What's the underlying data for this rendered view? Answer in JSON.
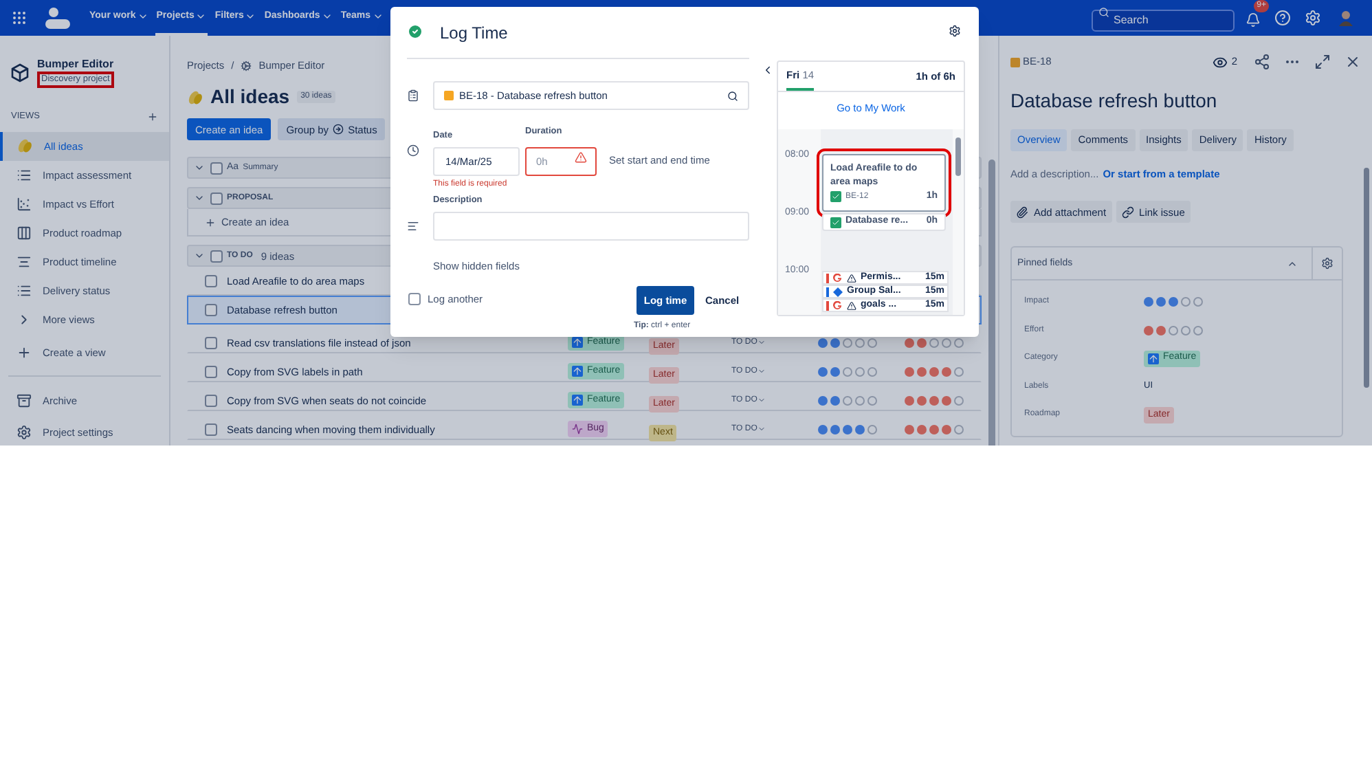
{
  "topnav": {
    "items": [
      {
        "label": "Your work",
        "selected": false
      },
      {
        "label": "Projects",
        "selected": true
      },
      {
        "label": "Filters",
        "selected": false
      },
      {
        "label": "Dashboards",
        "selected": false
      },
      {
        "label": "Teams",
        "selected": false
      }
    ],
    "search": {
      "placeholder": "Search"
    },
    "notifications_badge": "9+"
  },
  "sidebar": {
    "project_name": "Bumper Editor",
    "project_type": "Discovery project",
    "project_type_highlighted": true,
    "views_heading": "VIEWS",
    "items": [
      {
        "label": "All ideas",
        "kind": "ideas",
        "selected": true
      },
      {
        "label": "Impact assessment",
        "kind": "list",
        "selected": false
      },
      {
        "label": "Impact vs Effort",
        "kind": "matrix",
        "selected": false
      },
      {
        "label": "Product roadmap",
        "kind": "board",
        "selected": false
      },
      {
        "label": "Product timeline",
        "kind": "timeline",
        "selected": false
      },
      {
        "label": "Delivery status",
        "kind": "list",
        "selected": false
      },
      {
        "label": "More views",
        "kind": "more",
        "selected": false
      },
      {
        "label": "Create a view",
        "kind": "create",
        "selected": false
      }
    ],
    "footer_items": [
      {
        "label": "Archive",
        "kind": "archive"
      },
      {
        "label": "Project settings",
        "kind": "settings"
      }
    ]
  },
  "main": {
    "breadcrumb": [
      "Projects",
      "Bumper Editor"
    ],
    "breadcrumb_separator": "/",
    "title": "All ideas",
    "count": "30 ideas",
    "create_button": "Create an idea",
    "group_by": {
      "label": "Group by",
      "value": "Status"
    },
    "table": {
      "summary_icon": "Aa",
      "summary_header": "Summary",
      "select_all_checked": false,
      "groups": [
        {
          "name": "PROPOSAL",
          "expanded": true,
          "checked": false,
          "create_label": "Create an idea"
        },
        {
          "name": "TO DO",
          "expanded": true,
          "checked": false,
          "count": "9 ideas",
          "rows": [
            {
              "summary": "Load Areafile to do area maps",
              "checked": false,
              "selected": false
            },
            {
              "summary": "Database refresh button",
              "checked": false,
              "selected": true
            },
            {
              "summary": "Read csv translations file instead of json",
              "checked": false,
              "selected": false,
              "category": {
                "label": "Feature",
                "kind": "feature"
              },
              "roadmap": {
                "label": "Later",
                "kind": "later"
              },
              "status": "TO DO",
              "impact": {
                "stars": 2
              },
              "effort": {
                "stars": 2
              }
            },
            {
              "summary": "Copy from SVG labels in path",
              "checked": false,
              "selected": false,
              "category": {
                "label": "Feature",
                "kind": "feature"
              },
              "roadmap": {
                "label": "Later",
                "kind": "later"
              },
              "status": "TO DO",
              "impact": {
                "stars": 2
              },
              "effort": {
                "stars": 4
              }
            },
            {
              "summary": "Copy from SVG when seats do not coincide",
              "checked": false,
              "selected": false,
              "category": {
                "label": "Feature",
                "kind": "feature"
              },
              "roadmap": {
                "label": "Later",
                "kind": "later"
              },
              "status": "TO DO",
              "impact": {
                "stars": 2
              },
              "effort": {
                "stars": 4
              }
            },
            {
              "summary": "Seats dancing when moving them individually",
              "checked": false,
              "selected": false,
              "category": {
                "label": "Bug",
                "kind": "bug"
              },
              "roadmap": {
                "label": "Next",
                "kind": "next"
              },
              "status": "TO DO",
              "impact": {
                "stars": 4
              },
              "effort": {
                "stars": 4
              }
            }
          ]
        }
      ]
    }
  },
  "detail": {
    "key": "BE-18",
    "watchers": "2",
    "title": "Database refresh button",
    "tabs": [
      {
        "label": "Overview",
        "selected": true
      },
      {
        "label": "Comments",
        "selected": false
      },
      {
        "label": "Insights",
        "selected": false
      },
      {
        "label": "Delivery",
        "selected": false
      },
      {
        "label": "History",
        "selected": false
      }
    ],
    "description_placeholder": "Add a description...",
    "template_link": "Or start from a template",
    "actions": [
      {
        "label": "Add attachment",
        "kind": "attach"
      },
      {
        "label": "Link issue",
        "kind": "link"
      }
    ],
    "pinned": {
      "title": "Pinned fields",
      "expanded": true,
      "fields": [
        {
          "label": "Impact",
          "kind": "impact",
          "stars": 3
        },
        {
          "label": "Effort",
          "kind": "effort",
          "stars": 2
        },
        {
          "label": "Category",
          "kind": "category",
          "value": {
            "label": "Feature",
            "kind": "feature"
          }
        },
        {
          "label": "Labels",
          "kind": "text",
          "value": "UI"
        },
        {
          "label": "Roadmap",
          "kind": "tag",
          "value": {
            "label": "Later",
            "kind": "later"
          }
        }
      ]
    }
  },
  "dialog": {
    "title": "Log Time",
    "issue": "BE-18 - Database refresh button",
    "date": {
      "label": "Date",
      "value": "14/Mar/25",
      "error": "This field is required"
    },
    "duration": {
      "label": "Duration",
      "placeholder": "0h",
      "invalid": true
    },
    "set_time_link": "Set start and end time",
    "description": {
      "label": "Description"
    },
    "show_hidden": "Show hidden fields",
    "log_another": {
      "label": "Log another",
      "checked": false
    },
    "submit": "Log time",
    "cancel": "Cancel",
    "tip": "**Tip:** ctrl + enter",
    "calendar": {
      "day": "Fri",
      "date": "14",
      "total": "1h of 6h",
      "link": "Go to My Work",
      "hours": [
        "08:00",
        "09:00",
        "10:00"
      ],
      "events": [
        {
          "title": "Load Areafile to do area maps",
          "key": "BE-12",
          "duration": "1h",
          "highlighted": true
        },
        {
          "title": "Database re...",
          "duration": "0h",
          "highlighted": false
        }
      ],
      "entries": [
        {
          "title": "Permis...",
          "duration": "15m",
          "kind": "google",
          "warning": true,
          "color": "#e2483d"
        },
        {
          "title": "Group Sal...",
          "duration": "15m",
          "kind": "jira",
          "warning": false,
          "color": "#1868db"
        },
        {
          "title": "goals ...",
          "duration": "15m",
          "kind": "google",
          "warning": true,
          "color": "#e2483d"
        }
      ]
    }
  }
}
